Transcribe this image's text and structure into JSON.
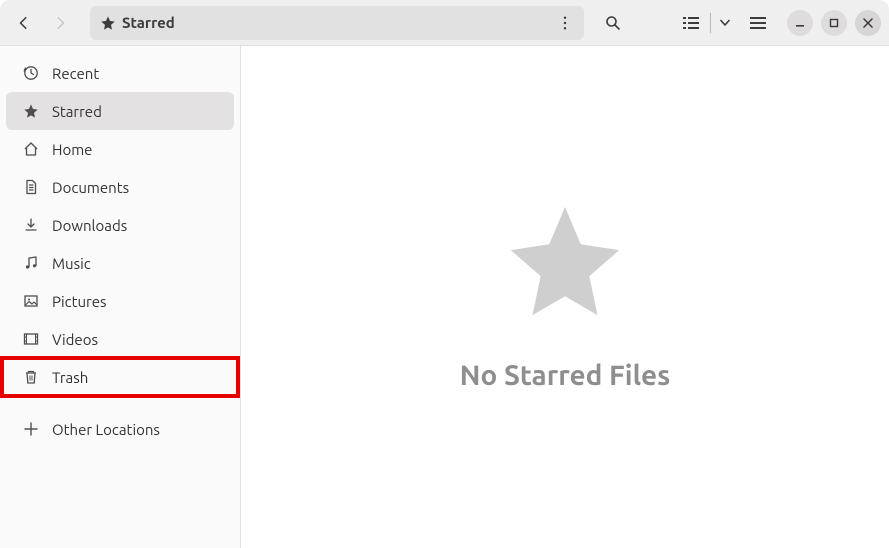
{
  "header": {
    "path_label": "Starred"
  },
  "sidebar": {
    "items": [
      {
        "icon": "clock-icon",
        "label": "Recent"
      },
      {
        "icon": "star-icon",
        "label": "Starred"
      },
      {
        "icon": "home-icon",
        "label": "Home"
      },
      {
        "icon": "document-icon",
        "label": "Documents"
      },
      {
        "icon": "download-icon",
        "label": "Downloads"
      },
      {
        "icon": "music-icon",
        "label": "Music"
      },
      {
        "icon": "picture-icon",
        "label": "Pictures"
      },
      {
        "icon": "video-icon",
        "label": "Videos"
      }
    ],
    "trash_label": "Trash",
    "other_locations_label": "Other Locations"
  },
  "main": {
    "empty_text": "No Starred Files"
  }
}
